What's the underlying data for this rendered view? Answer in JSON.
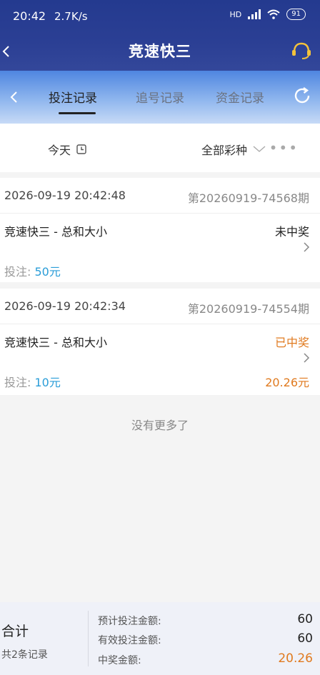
{
  "status_bar": {
    "time": "20:42",
    "net_speed": "2.7K/s",
    "network": "HD",
    "battery": "91"
  },
  "header": {
    "title": "竞速快三",
    "back_icon": "chevron-left-icon",
    "service_icon": "headset-icon"
  },
  "tabs": {
    "items": [
      {
        "label": "投注记录",
        "active": true
      },
      {
        "label": "追号记录",
        "active": false
      },
      {
        "label": "资金记录",
        "active": false
      }
    ]
  },
  "filters": {
    "date": "今天",
    "lottery_type": "全部彩种",
    "more": "•••"
  },
  "records": [
    {
      "datetime": "2026-09-19 20:42:48",
      "issue": "第20260919-74568期",
      "game": "竞速快三 - 总和大小",
      "result": "未中奖",
      "bet_label": "投注:",
      "bet_amount": "50元",
      "prize": ""
    },
    {
      "datetime": "2026-09-19 20:42:34",
      "issue": "第20260919-74554期",
      "game": "竞速快三 - 总和大小",
      "result": "已中奖",
      "bet_label": "投注:",
      "bet_amount": "10元",
      "prize": "20.26元"
    }
  ],
  "no_more_text": "没有更多了",
  "summary": {
    "title": "合计",
    "count": "共2条记录",
    "rows": [
      {
        "label": "预计投注金额:",
        "value": "60"
      },
      {
        "label": "有效投注金额:",
        "value": "60"
      },
      {
        "label": "中奖金额:",
        "value": "20.26"
      }
    ]
  },
  "colors": {
    "header_bg": "#2b3f94",
    "win": "#e07a1f",
    "bet_amount": "#2a9dd8"
  }
}
